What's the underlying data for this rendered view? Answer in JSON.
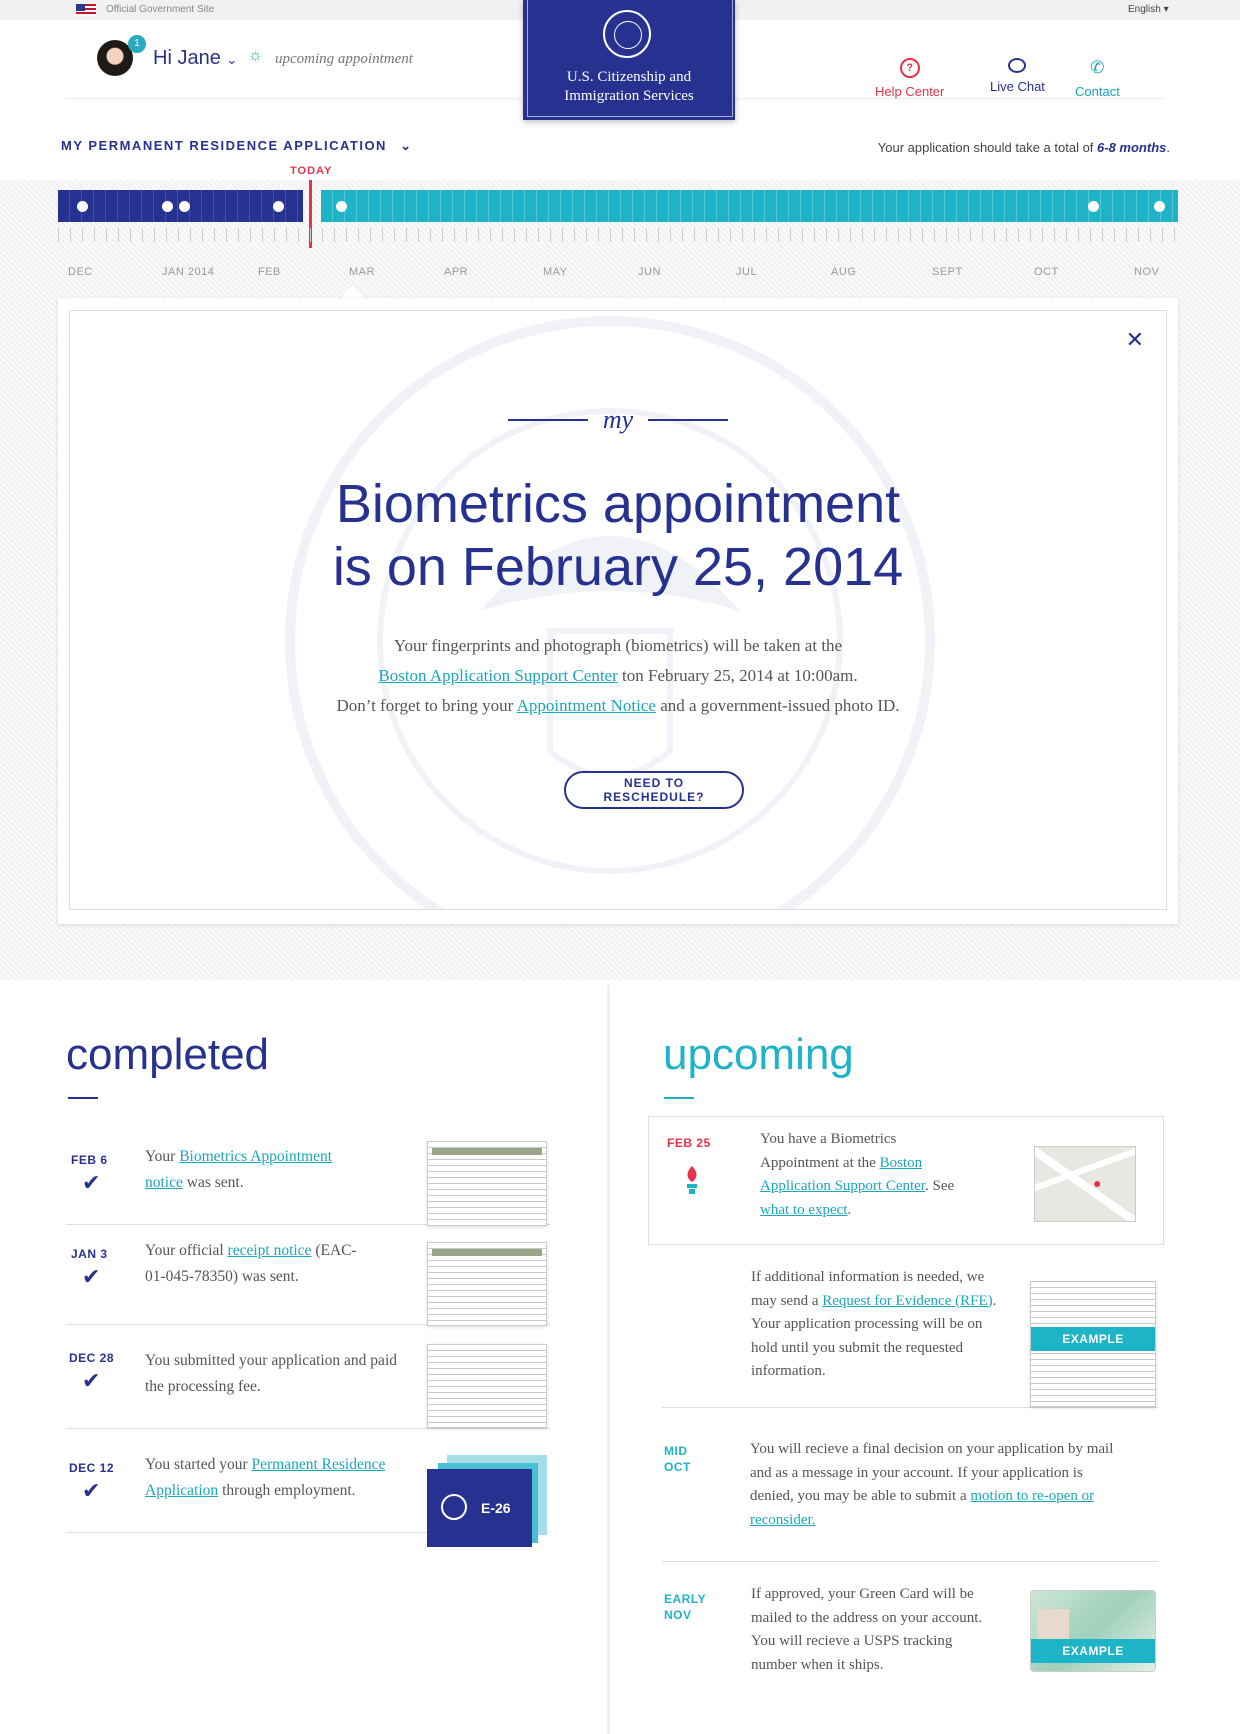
{
  "gov_bar": {
    "label": "Official Government Site",
    "language": "English ▾"
  },
  "user": {
    "greeting": "Hi Jane",
    "notifications": "1",
    "status": "upcoming appointment"
  },
  "nav": {
    "help": "Help Center",
    "chat": "Live Chat",
    "contact": "Contact"
  },
  "agency": {
    "line1": "U.S. Citizenship and",
    "line2": "Immigration Services"
  },
  "application": {
    "title": "MY PERMANENT RESIDENCE APPLICATION",
    "duration_prefix": "Your application should take a total of ",
    "duration_value": "6-8 months",
    "duration_suffix": "."
  },
  "timeline": {
    "today_label": "TODAY",
    "months": [
      "DEC",
      "JAN 2014",
      "FEB",
      "MAR",
      "APR",
      "MAY",
      "JUN",
      "JUL",
      "AUG",
      "SEPT",
      "OCT",
      "NOV"
    ]
  },
  "modal": {
    "script_word": "my",
    "headline_1": "Biometrics appointment",
    "headline_2": "is on February 25, 2014",
    "body_1": "Your fingerprints and photograph (biometrics) will be taken at the",
    "body_link_1": "Boston Application Support Center",
    "body_2": " ton February 25, 2014 at 10:00am.",
    "body_3": "Don’t forget to bring your ",
    "body_link_2": "Appointment Notice",
    "body_4": " and a government-issued photo ID.",
    "button": "NEED TO RESCHEDULE?"
  },
  "completed": {
    "title": "completed",
    "items": [
      {
        "date": "FEB 6",
        "pre": "Your ",
        "link": "Biometrics Appointment notice",
        "post": " was sent."
      },
      {
        "date": "JAN 3",
        "pre": "Your official ",
        "link": "receipt notice",
        "post": " (EAC-01-045-78350) was sent."
      },
      {
        "date": "DEC 28",
        "pre": "You submitted your application and paid the processing fee.",
        "link": "",
        "post": ""
      },
      {
        "date": "DEC 12",
        "pre": "You started your ",
        "link": "Permanent Residence Application",
        "post": " through employment."
      }
    ],
    "e26_label": "E-26"
  },
  "upcoming": {
    "title": "upcoming",
    "items": [
      {
        "date": "FEB 25",
        "pre": "You have a Biometrics Appointment at the ",
        "link": "Boston Application Support Center",
        "mid": ". See ",
        "link2": "what to expect",
        "post": "."
      },
      {
        "date": "",
        "pre": "If additional information is needed, we may send a ",
        "link": "Request for Evidence (RFE)",
        "post": ". Your application processing will be on hold until you submit the requested information."
      },
      {
        "date": "MID OCT",
        "pre": "You will recieve a final decision on your application by mail and as a message in your account. If your application is denied, you may be able to submit a ",
        "link": "motion to re-open or reconsider.",
        "post": ""
      },
      {
        "date": "EARLY NOV",
        "pre": "If approved, your Green Card will be mailed to the address on your account. You will recieve a USPS tracking number when it ships.",
        "link": "",
        "post": ""
      }
    ],
    "example_label": "EXAMPLE"
  },
  "colors": {
    "navy": "#27318f",
    "teal": "#1cb4c6",
    "today": "#e6334b"
  }
}
